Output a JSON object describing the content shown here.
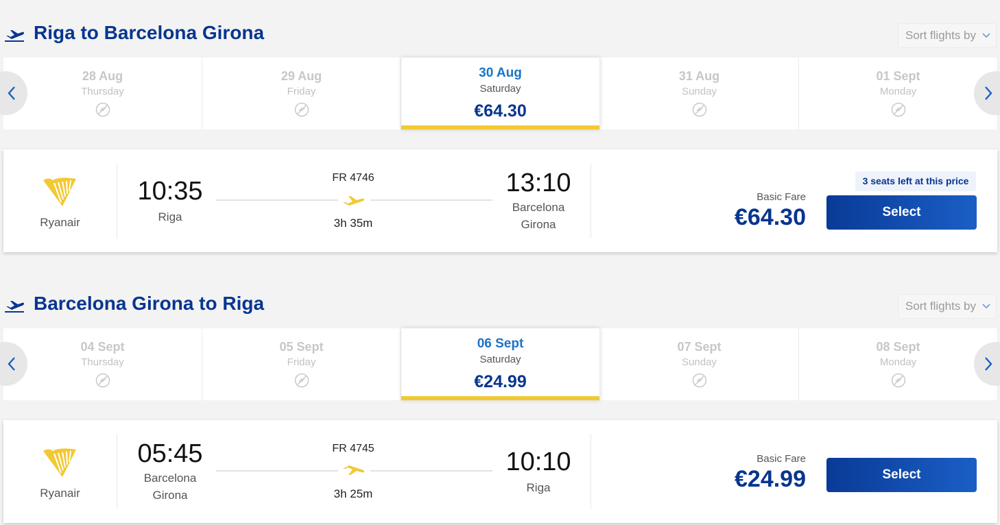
{
  "outbound": {
    "title": "Riga to Barcelona Girona",
    "sort_label": "Sort flights by",
    "dates": [
      {
        "date": "28 Aug",
        "day": "Thursday",
        "price": ""
      },
      {
        "date": "29 Aug",
        "day": "Friday",
        "price": ""
      },
      {
        "date": "30 Aug",
        "day": "Saturday",
        "price": "€64.30"
      },
      {
        "date": "31 Aug",
        "day": "Sunday",
        "price": ""
      },
      {
        "date": "01 Sept",
        "day": "Monday",
        "price": ""
      }
    ],
    "selected_index": 2,
    "flight": {
      "airline": "Ryanair",
      "depart_time": "10:35",
      "depart_city": "Riga",
      "flight_number": "FR 4746",
      "duration": "3h 35m",
      "arrive_time": "13:10",
      "arrive_city_line1": "Barcelona",
      "arrive_city_line2": "Girona",
      "seats_note": "3 seats left at this price",
      "fare_label": "Basic Fare",
      "price": "€64.30",
      "select_label": "Select"
    }
  },
  "return": {
    "title": "Barcelona Girona to Riga",
    "sort_label": "Sort flights by",
    "dates": [
      {
        "date": "04 Sept",
        "day": "Thursday",
        "price": ""
      },
      {
        "date": "05 Sept",
        "day": "Friday",
        "price": ""
      },
      {
        "date": "06 Sept",
        "day": "Saturday",
        "price": "€24.99"
      },
      {
        "date": "07 Sept",
        "day": "Sunday",
        "price": ""
      },
      {
        "date": "08 Sept",
        "day": "Monday",
        "price": ""
      }
    ],
    "selected_index": 2,
    "flight": {
      "airline": "Ryanair",
      "depart_time": "05:45",
      "depart_city_line1": "Barcelona",
      "depart_city_line2": "Girona",
      "flight_number": "FR 4745",
      "duration": "3h 25m",
      "arrive_time": "10:10",
      "arrive_city": "Riga",
      "fare_label": "Basic Fare",
      "price": "€24.99",
      "select_label": "Select"
    }
  },
  "icons": {
    "header": "departure-plane-icon",
    "no_flights": "no-flights-icon",
    "nav_prev": "chevron-left-icon",
    "nav_next": "chevron-right-icon",
    "sort": "chevron-down-icon",
    "airline_logo": "ryanair-harp-logo",
    "route": "plane-icon"
  },
  "colors": {
    "brand_blue": "#073590",
    "accent_yellow": "#f1c933",
    "link_blue": "#1a73c8"
  }
}
